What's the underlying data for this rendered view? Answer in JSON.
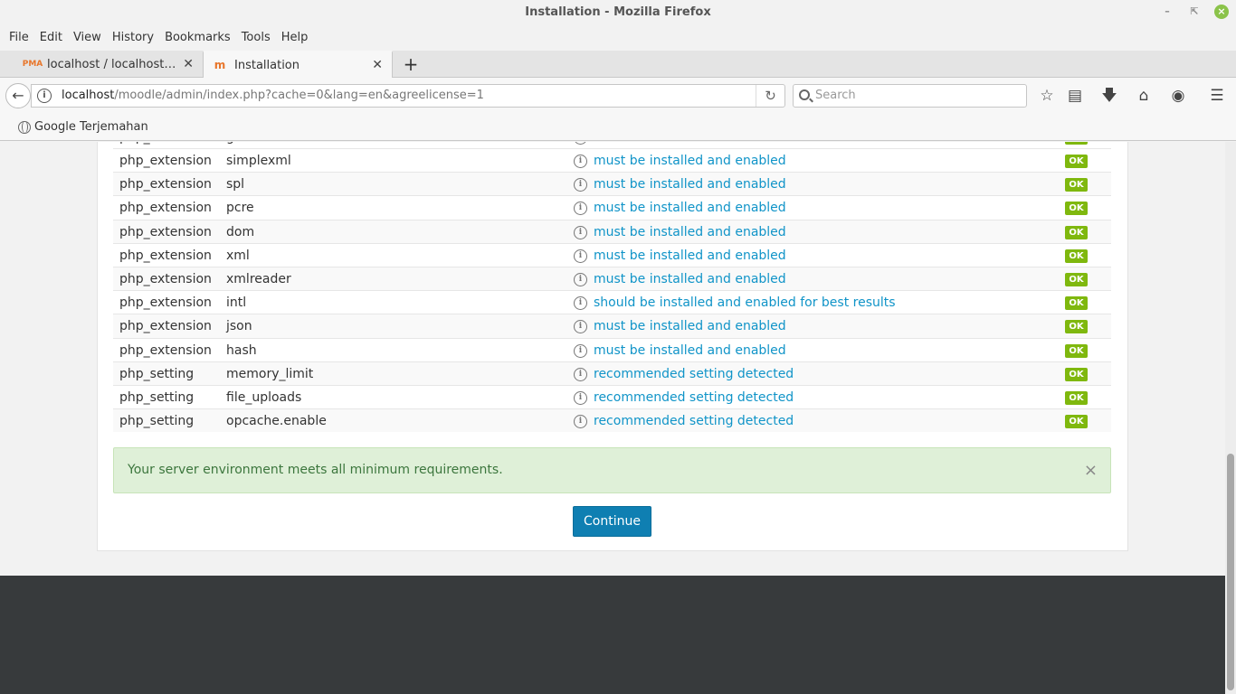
{
  "window": {
    "title": "Installation - Mozilla Firefox"
  },
  "menu": [
    "File",
    "Edit",
    "View",
    "History",
    "Bookmarks",
    "Tools",
    "Help"
  ],
  "tabs": [
    {
      "label": "localhost / localhost | ph…",
      "icon": "phpmyadmin-icon"
    },
    {
      "label": "Installation",
      "icon": "moodle-icon"
    }
  ],
  "pma_icon_text": "PMA",
  "address": {
    "host": "localhost",
    "path": "/moodle/admin/index.php?cache=0&lang=en&agreelicense=1"
  },
  "search": {
    "placeholder": "Search"
  },
  "bookmarks": [
    {
      "label": "Google Terjemahan"
    }
  ],
  "requirements": {
    "partial_row": {
      "name": "php_extension",
      "info": "gd",
      "report": "must be installed and enabled",
      "status": "OK"
    },
    "rows": [
      {
        "name": "php_extension",
        "info": "simplexml",
        "report": "must be installed and enabled",
        "status": "OK"
      },
      {
        "name": "php_extension",
        "info": "spl",
        "report": "must be installed and enabled",
        "status": "OK"
      },
      {
        "name": "php_extension",
        "info": "pcre",
        "report": "must be installed and enabled",
        "status": "OK"
      },
      {
        "name": "php_extension",
        "info": "dom",
        "report": "must be installed and enabled",
        "status": "OK"
      },
      {
        "name": "php_extension",
        "info": "xml",
        "report": "must be installed and enabled",
        "status": "OK"
      },
      {
        "name": "php_extension",
        "info": "xmlreader",
        "report": "must be installed and enabled",
        "status": "OK"
      },
      {
        "name": "php_extension",
        "info": "intl",
        "report": "should be installed and enabled for best results",
        "status": "OK"
      },
      {
        "name": "php_extension",
        "info": "json",
        "report": "must be installed and enabled",
        "status": "OK"
      },
      {
        "name": "php_extension",
        "info": "hash",
        "report": "must be installed and enabled",
        "status": "OK"
      },
      {
        "name": "php_setting",
        "info": "memory_limit",
        "report": "recommended setting detected",
        "status": "OK"
      },
      {
        "name": "php_setting",
        "info": "file_uploads",
        "report": "recommended setting detected",
        "status": "OK"
      },
      {
        "name": "php_setting",
        "info": "opcache.enable",
        "report": "recommended setting detected",
        "status": "OK"
      }
    ]
  },
  "alert": {
    "message": "Your server environment meets all minimum requirements.",
    "close": "×"
  },
  "continue_label": "Continue",
  "colors": {
    "link": "#1094c8",
    "ok": "#7fb80e",
    "primary_button": "#0f7fb2",
    "alert_bg": "#dff0d8",
    "footer": "#373a3c"
  }
}
